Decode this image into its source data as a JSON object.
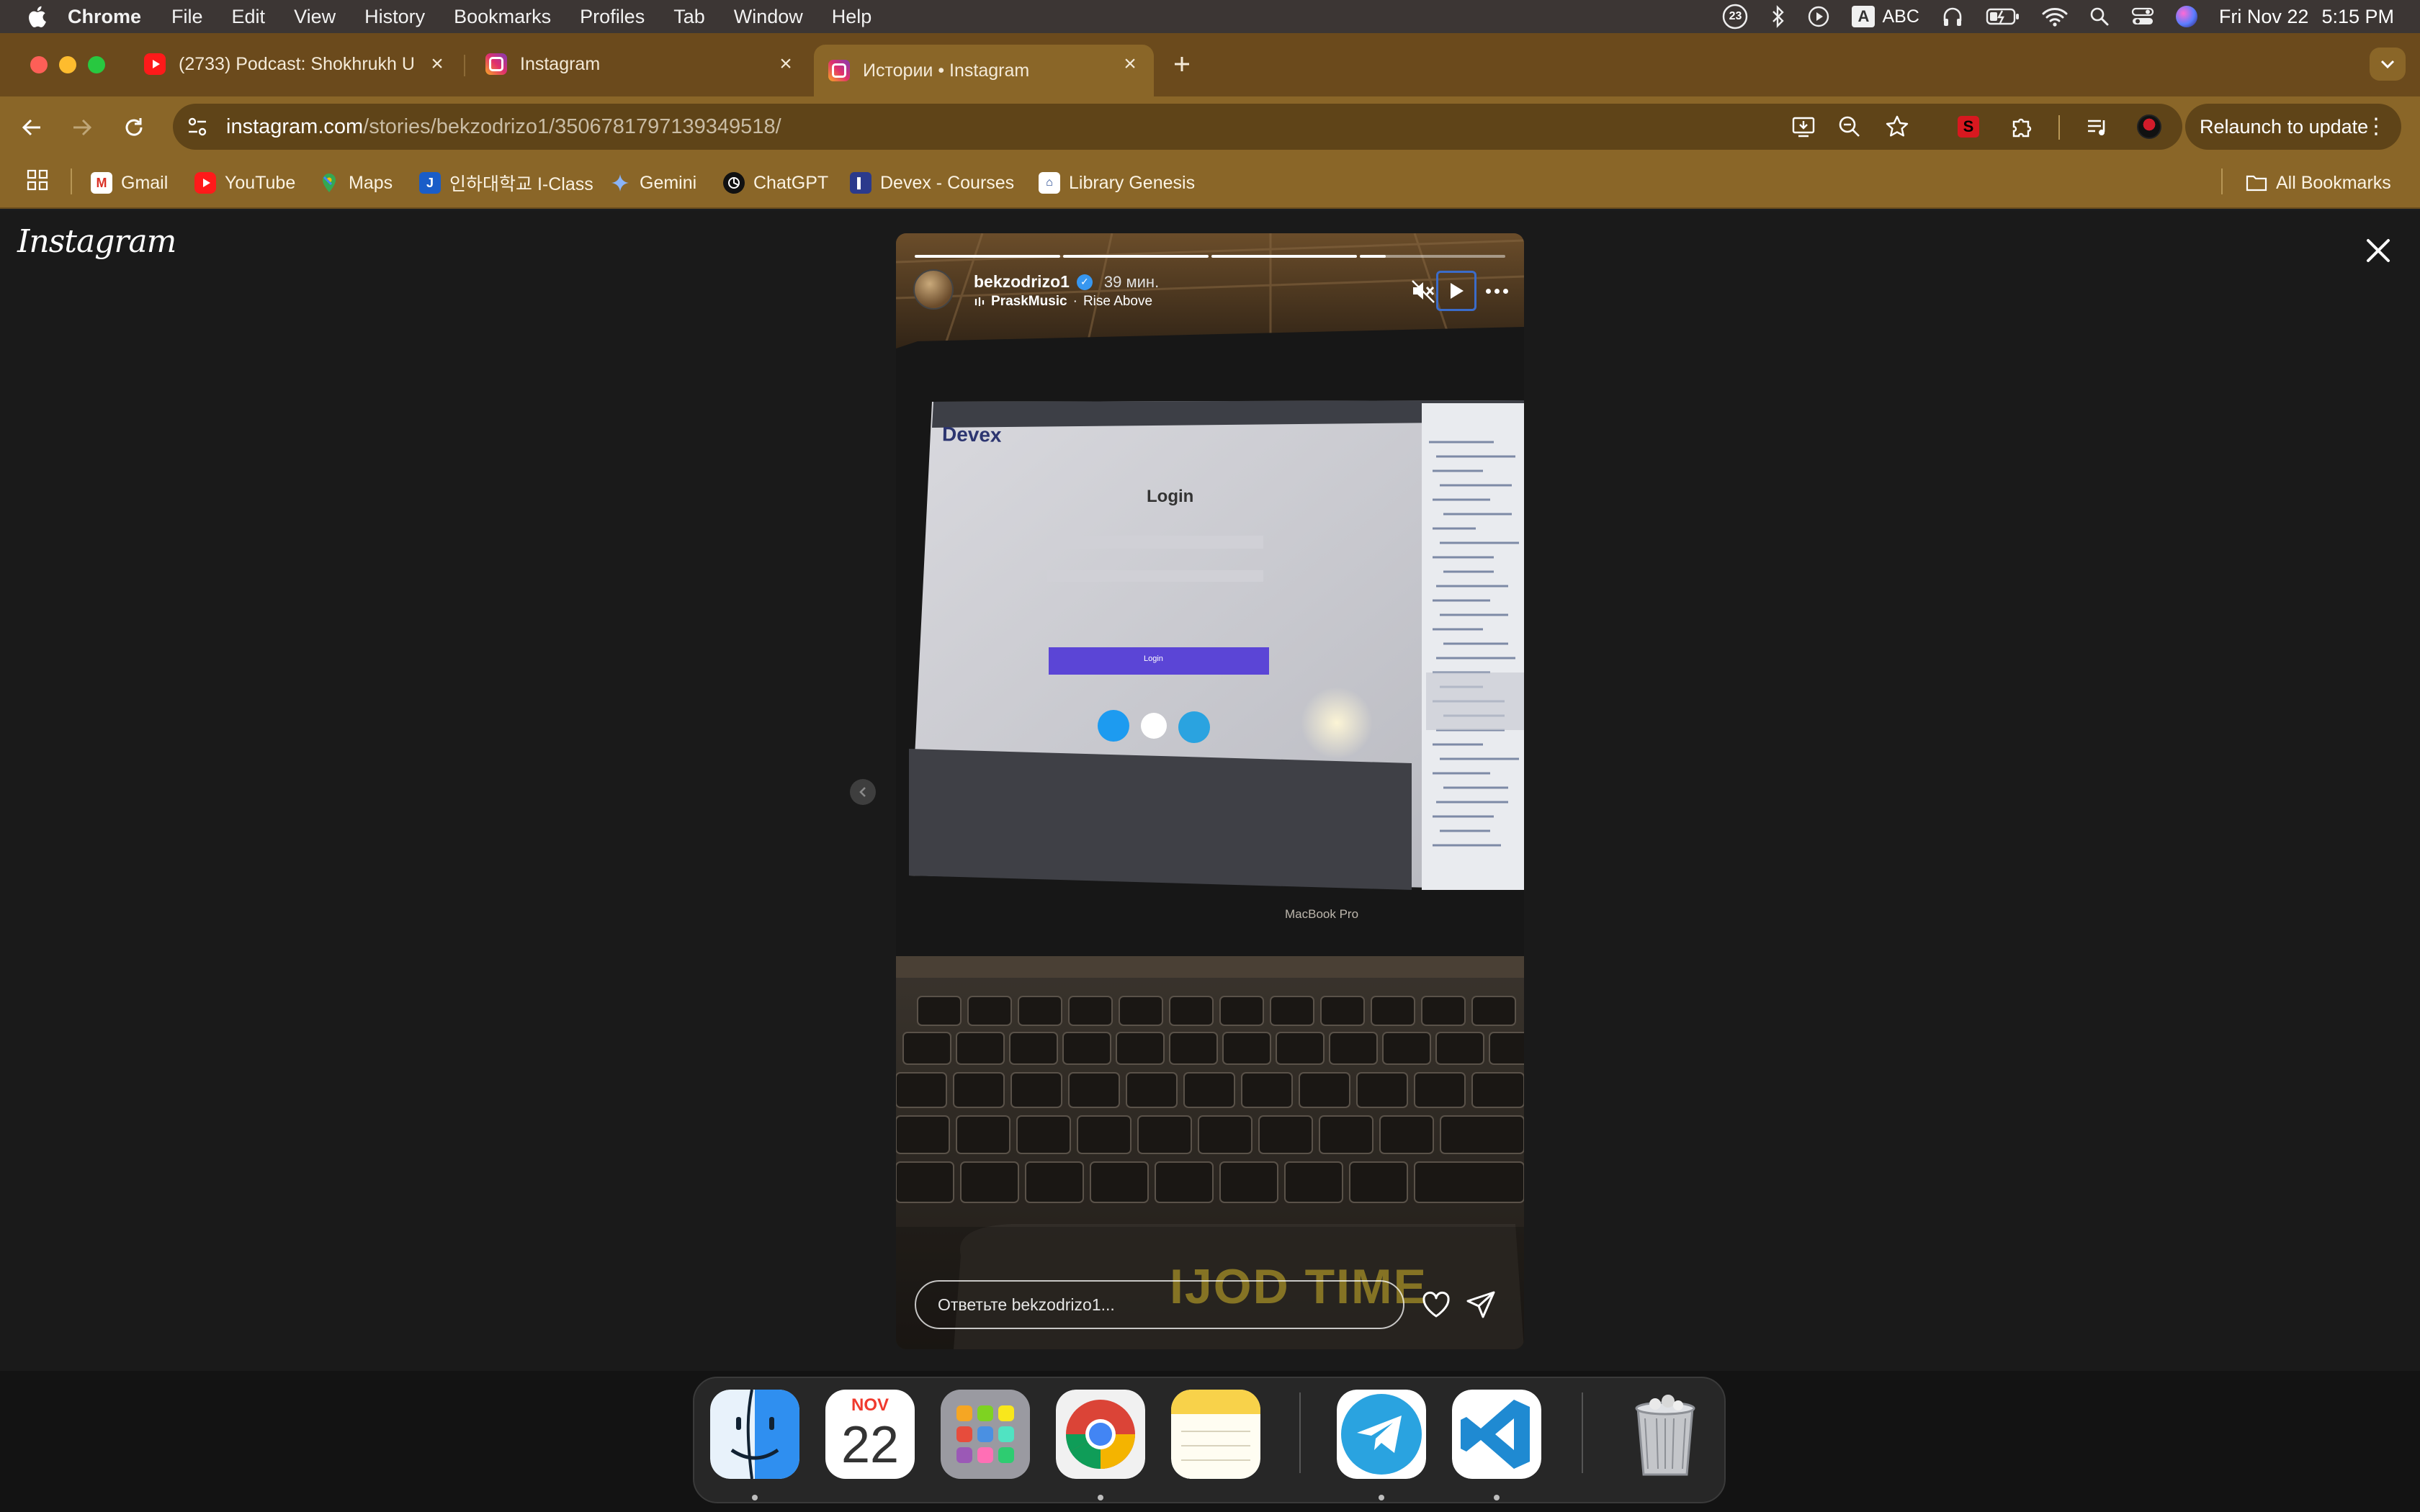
{
  "menubar": {
    "app_name": "Chrome",
    "items": [
      "File",
      "Edit",
      "View",
      "History",
      "Bookmarks",
      "Profiles",
      "Tab",
      "Window",
      "Help"
    ],
    "notification_count": "23",
    "input_source": "ABC",
    "input_source_glyph": "A",
    "date": "Fri Nov 22",
    "time": "5:15 PM"
  },
  "tabs": [
    {
      "title": "(2733) Podcast: Shokhrukh U",
      "icon": "youtube-icon",
      "active": false
    },
    {
      "title": "Instagram",
      "icon": "instagram-icon",
      "active": false
    },
    {
      "title": "Истории • Instagram",
      "icon": "instagram-icon",
      "active": true
    }
  ],
  "toolbar": {
    "url_host": "instagram.com",
    "url_path": "/stories/bekzodrizo1/3506781797139349518/",
    "relaunch_label": "Relaunch to update"
  },
  "bookmarks": [
    {
      "label": "Gmail",
      "icon": "gmail-icon"
    },
    {
      "label": "YouTube",
      "icon": "youtube-icon"
    },
    {
      "label": "Maps",
      "icon": "maps-icon"
    },
    {
      "label": "인하대학교 I-Class",
      "icon": "iclass-icon"
    },
    {
      "label": "Gemini",
      "icon": "gemini-icon"
    },
    {
      "label": "ChatGPT",
      "icon": "chatgpt-icon"
    },
    {
      "label": "Devex - Courses",
      "icon": "devex-icon"
    },
    {
      "label": "Library Genesis",
      "icon": "library-icon"
    }
  ],
  "all_bookmarks_label": "All Bookmarks",
  "instagram": {
    "logo_text": "Instagram",
    "story": {
      "username": "bekzodrizo1",
      "time_ago": "39 мин.",
      "music_artist": "PraskMusic",
      "music_separator": "·",
      "music_title": "Rise Above",
      "segments_total": 4,
      "segments_completed": 3,
      "reply_placeholder": "Ответьте bekzodrizo1...",
      "photo_texts": {
        "site_logo": "Devex",
        "login_heading": "Login",
        "login_button": "Login",
        "laptop_label": "MacBook Pro",
        "watermark": "IJOD TIME"
      }
    }
  },
  "dock": {
    "calendar_month": "NOV",
    "calendar_day": "22",
    "apps": [
      "Finder",
      "Calendar",
      "Launchpad",
      "Chrome",
      "Notes",
      "Telegram",
      "Visual Studio Code",
      "Trash"
    ]
  },
  "colors": {
    "tab_strip": "#6b4a1c",
    "toolbar": "#8a6628",
    "page_bg": "#1a1a1a",
    "menubar": "#3c3634"
  }
}
